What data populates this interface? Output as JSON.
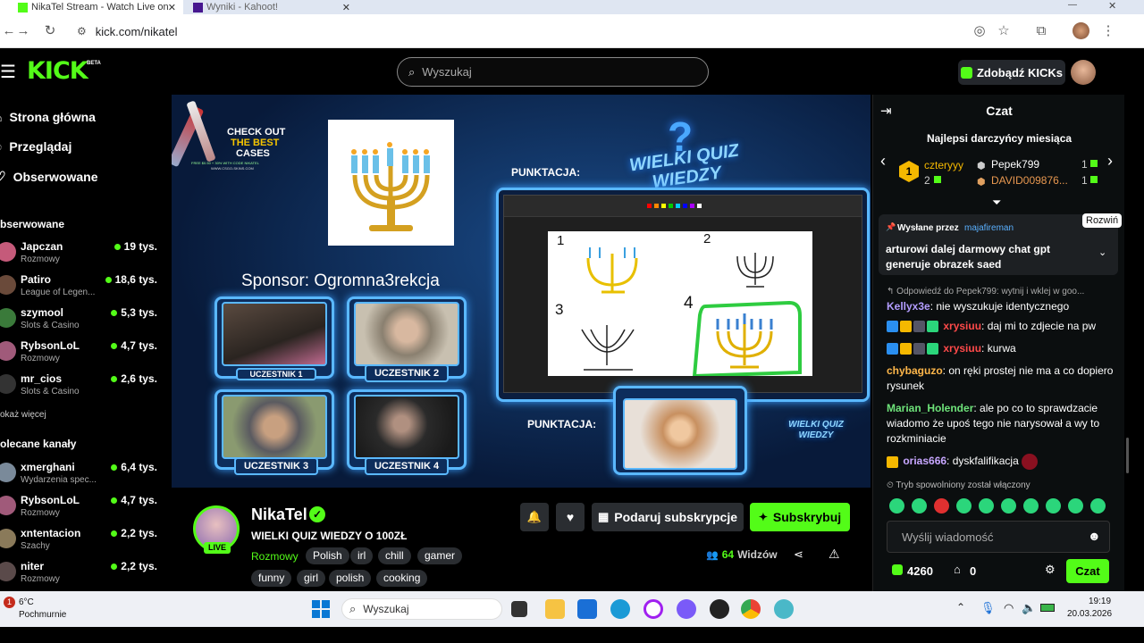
{
  "browser": {
    "tabs": [
      {
        "title": "NikaTel Stream - Watch Live on"
      },
      {
        "title": "Wyniki - Kahoot!"
      }
    ],
    "url": "kick.com/nikatel"
  },
  "header": {
    "logo": "KICK",
    "logo_badge": "BETA",
    "search_placeholder": "Wyszukaj",
    "get_kicks_label": "Zdobądź KICKs"
  },
  "sidebar": {
    "nav": [
      {
        "label": "Strona główna",
        "icon": "home-icon"
      },
      {
        "label": "Przeglądaj",
        "icon": "compass-icon"
      },
      {
        "label": "Obserwowane",
        "icon": "heart-icon"
      }
    ],
    "followed_title": "bserwowane",
    "followed": [
      {
        "name": "Japczan",
        "category": "Rozmowy",
        "viewers": "19 tys."
      },
      {
        "name": "Patiro",
        "category": "League of Legen...",
        "viewers": "18,6 tys."
      },
      {
        "name": "szymool",
        "category": "Slots & Casino",
        "viewers": "5,3 tys."
      },
      {
        "name": "RybsonLoL",
        "category": "Rozmowy",
        "viewers": "4,7 tys."
      },
      {
        "name": "mr_cios",
        "category": "Slots & Casino",
        "viewers": "2,6 tys."
      }
    ],
    "show_more": "okaż więcej",
    "recommended_title": "olecane kanały",
    "recommended": [
      {
        "name": "xmerghani",
        "category": "Wydarzenia spec...",
        "viewers": "6,4 tys."
      },
      {
        "name": "RybsonLoL",
        "category": "Rozmowy",
        "viewers": "4,7 tys."
      },
      {
        "name": "xntentacion",
        "category": "Szachy",
        "viewers": "2,2 tys."
      },
      {
        "name": "niter",
        "category": "Rozmowy",
        "viewers": "2,2 tys."
      }
    ]
  },
  "video": {
    "ad_line1": "CHECK OUT",
    "ad_line2": "THE BEST",
    "ad_line3": "CASES",
    "ad_small": "FREE $0.50 + 30% WITH CODE NIKATEL",
    "ad_url": "WWW.CSGO-SKINS.COM",
    "sponsor": "Sponsor: Ogromna3rekcja",
    "score_label_top": "PUNKTACJA:",
    "score_label_bottom": "PUNKTACJA:",
    "quiz_logo": "WIELKI QUIZ WIEDZY",
    "participants": [
      "UCZESTNIK 1",
      "UCZESTNIK 2",
      "UCZESTNIK 3",
      "UCZESTNIK 4"
    ],
    "drawing_numbers": [
      "1",
      "2",
      "3",
      "4"
    ]
  },
  "channel": {
    "name": "NikaTel",
    "live_badge": "LIVE",
    "title": "WIELKI QUIZ WIEDZY O 100ZŁ",
    "category": "Rozmowy",
    "tags": [
      "Polish",
      "irl",
      "chill",
      "gamer",
      "funny",
      "girl",
      "polish",
      "cooking"
    ],
    "gift_sub_label": "Podaruj subskrypcje",
    "subscribe_label": "Subskrybuj",
    "viewers_count": "64",
    "viewers_label": "Widzów"
  },
  "chat": {
    "title": "Czat",
    "top_donors_title": "Najlepsi darczyńcy miesiąca",
    "top_donors": [
      {
        "rank": "1",
        "name": "czteryyy",
        "amount": "2"
      },
      {
        "name": "Pepek799",
        "amount": "1"
      },
      {
        "name": "DAVID009876...",
        "amount": "1"
      }
    ],
    "pinned_by_label": "Wysłane przez",
    "pinned_by_user": "majafireman",
    "pinned_text": "arturowi dalej darmowy chat gpt generuje obrazek saed",
    "expand_tooltip": "Rozwiń",
    "messages": [
      {
        "reply": "Odpowiedź do Pepek799: wytnij i wklej w goo...",
        "user": "Kellyx3e",
        "text": ": nie wyszukuje identycznego",
        "color": "#b39dff"
      },
      {
        "user": "xrysiuu",
        "text": ": daj mi to zdjecie na pw",
        "color": "#ff4a4a"
      },
      {
        "user": "xrysiuu",
        "text": ": kurwa",
        "color": "#ff4a4a"
      },
      {
        "user": "chybaguzo",
        "text": ": on ręki prostej nie ma a co dopiero rysunek",
        "color": "#ffb74a"
      },
      {
        "user": "Marian_Holender",
        "text": ": ale po co to sprawdzacie wiadomo że upoś tego nie narysował a wy to rozkminiacie",
        "color": "#6ee37a"
      },
      {
        "user": "orias666",
        "text": ": dyskfalifikacja",
        "color": "#c7a6ff"
      }
    ],
    "slow_mode": "Tryb spowolniony został włączony",
    "input_placeholder": "Wyślij wiadomość",
    "kicks_count": "4260",
    "store_count": "0",
    "send_label": "Czat"
  },
  "taskbar": {
    "weather_temp": "6°C",
    "weather_desc": "Pochmurnie",
    "weather_alert": "1",
    "search_placeholder": "Wyszukaj",
    "time": "19:19",
    "date": "20.03.2026"
  }
}
